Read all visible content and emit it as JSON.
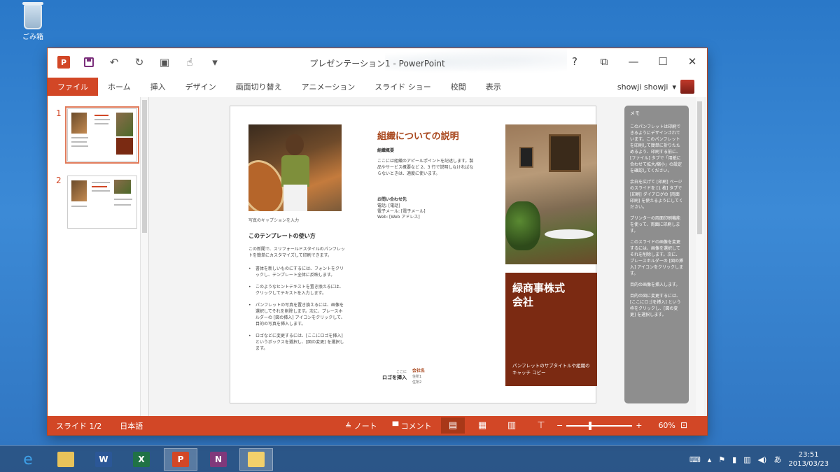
{
  "desktop": {
    "recycle_label": "ごみ箱"
  },
  "window": {
    "title": "プレゼンテーション1 - PowerPoint",
    "help": "?",
    "qat": {
      "logo": "P"
    }
  },
  "ribbon": {
    "tabs": [
      "ファイル",
      "ホーム",
      "挿入",
      "デザイン",
      "画面切り替え",
      "アニメーション",
      "スライド ショー",
      "校閲",
      "表示"
    ],
    "user": "showji showji"
  },
  "thumbs": [
    {
      "num": "1"
    },
    {
      "num": "2"
    }
  ],
  "slide": {
    "caption": "写真のキャプションを入力",
    "howto_title": "このテンプレートの使い方",
    "howto_body": "この新聞で、スリフォールドスタイルのパンフレットを簡単にカスタマイズして印刷できます。",
    "bullets": [
      "書体を新しいものにするには、フォントをクリックし、テンプレート全体に反映します。",
      "このようなヒントテキストを置き換えるには、クリックしてテキストを入力します。",
      "パンフレットの写真を置き換えるには、画像を選択してそれを削除します。次に、プレースホルダーの [図の挿入] アイコンをクリックして、目的の写真を挿入します。",
      "ロゴなどに変更するには、[ここにロゴを挿入] というボックスを選択し、[図の変更] を選択します。"
    ],
    "org_title": "組織についての説明",
    "org_sub": "組織概要",
    "org_body": "ここには組織のアピールポイントを記述します。製品やサービス概要など 2、3 行で説明しなければならないときは、適度に使います。",
    "contact_title": "お問い合わせ先",
    "contact_lines": [
      "電話: [電話]",
      "電子メール: [電子メール]",
      "Web: [Web アドレス]"
    ],
    "logo_small": "ここに",
    "logo_big": "ロゴを挿入",
    "company_name": "会社名",
    "company_addr1": "住所1",
    "company_addr2": "住所2",
    "red_title_1": "緑商事株式",
    "red_title_2": "会社",
    "red_sub": "パンフレットのサブタイトルや組織のキャッチ コピー"
  },
  "notes": {
    "title": "メモ",
    "paragraphs": [
      "このパンフレットは印刷できるようにデザインされています。このパンフレットを印刷して簡単に折りたためるよう、印刷する前に、[ファイル] タブで「用紙に合わせて拡大/縮小」の設定を確認してください。",
      "余白を広げて [印刷] ページのスライドを [1 枚] タブで [印刷] ダイアログの [両面印刷] を使えるようにしてください。",
      "プリンターの両面印刷機能を使って、両面に印刷します。",
      "このスライドの画像を変更するには、画像を選択してそれを削除します。次に、プレースホルダーの [図の挿入] アイコンをクリックします。",
      "目的の画像を挿入します。",
      "目的の図に変更するには、[ここにロゴを挿入] という枠をクリックし、[図の変更] を選択します。"
    ]
  },
  "status": {
    "slide": "スライド 1/2",
    "lang": "日本語",
    "notes": "ノート",
    "comments": "コメント",
    "zoom": "60%"
  },
  "taskbar": {
    "time": "23:51",
    "date": "2013/03/23",
    "ime": "あ"
  }
}
